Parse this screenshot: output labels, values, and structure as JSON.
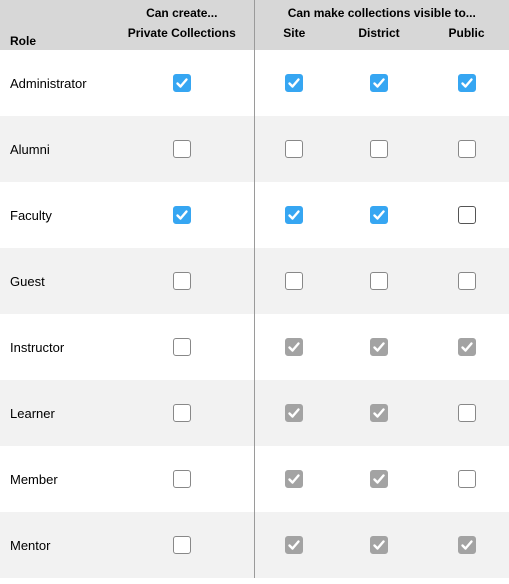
{
  "headers": {
    "role": "Role",
    "group_create": "Can create...",
    "group_visible": "Can make collections visible to...",
    "private_collections": "Private Collections",
    "site": "Site",
    "district": "District",
    "public": "Public"
  },
  "rows": [
    {
      "role": "Administrator",
      "private": "checked-blue",
      "site": "checked-blue",
      "district": "checked-blue",
      "public": "checked-blue"
    },
    {
      "role": "Alumni",
      "private": "unchecked",
      "site": "unchecked",
      "district": "unchecked",
      "public": "unchecked"
    },
    {
      "role": "Faculty",
      "private": "checked-blue",
      "site": "checked-blue",
      "district": "checked-blue",
      "public": "unchecked-dark"
    },
    {
      "role": "Guest",
      "private": "unchecked",
      "site": "unchecked",
      "district": "unchecked",
      "public": "unchecked"
    },
    {
      "role": "Instructor",
      "private": "unchecked",
      "site": "checked-gray",
      "district": "checked-gray",
      "public": "checked-gray"
    },
    {
      "role": "Learner",
      "private": "unchecked",
      "site": "checked-gray",
      "district": "checked-gray",
      "public": "unchecked"
    },
    {
      "role": "Member",
      "private": "unchecked",
      "site": "checked-gray",
      "district": "checked-gray",
      "public": "unchecked"
    },
    {
      "role": "Mentor",
      "private": "unchecked",
      "site": "checked-gray",
      "district": "checked-gray",
      "public": "checked-gray"
    }
  ]
}
